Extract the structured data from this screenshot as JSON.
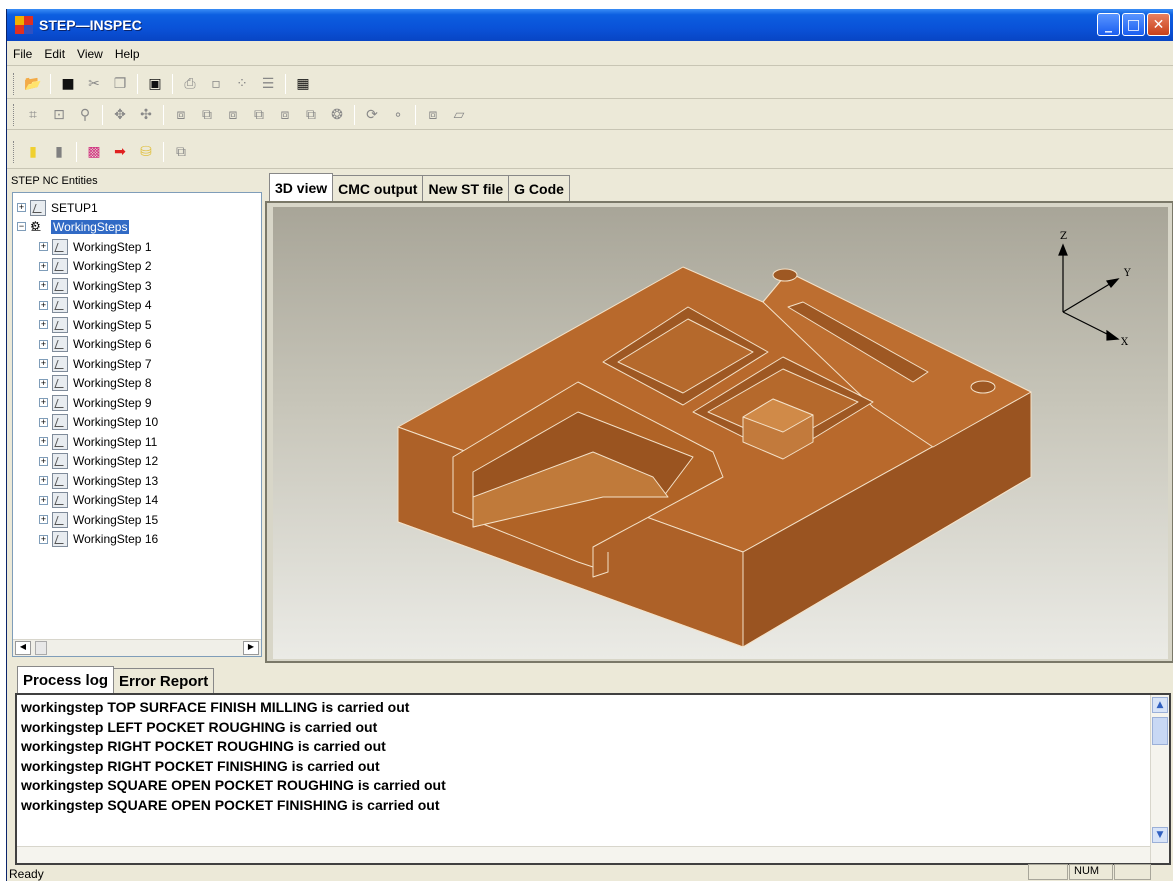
{
  "window": {
    "title": "STEP—INSPEC"
  },
  "menu": [
    "File",
    "Edit",
    "View",
    "Help"
  ],
  "tree": {
    "caption": "STEP NC Entities",
    "root_setup": "SETUP1",
    "root_workingsteps": "WorkingSteps",
    "items": [
      "WorkingStep 1",
      "WorkingStep 2",
      "WorkingStep 3",
      "WorkingStep 4",
      "WorkingStep 5",
      "WorkingStep 6",
      "WorkingStep 7",
      "WorkingStep 8",
      "WorkingStep 9",
      "WorkingStep 10",
      "WorkingStep 11",
      "WorkingStep 12",
      "WorkingStep 13",
      "WorkingStep 14",
      "WorkingStep 15",
      "WorkingStep 16"
    ]
  },
  "view_tabs": [
    "3D view",
    "CMC output",
    "New ST file",
    "G Code"
  ],
  "axes": {
    "z": "Z",
    "y": "Y",
    "x": "X"
  },
  "log_tabs": [
    "Process log",
    "Error Report"
  ],
  "log_lines": [
    "workingstep TOP SURFACE FINISH MILLING is carried out",
    "workingstep LEFT POCKET ROUGHING is carried out",
    "workingstep RIGHT POCKET ROUGHING is carried out",
    "workingstep RIGHT POCKET FINISHING is carried out",
    "workingstep SQUARE OPEN POCKET ROUGHING is carried out",
    "workingstep SQUARE OPEN POCKET FINISHING is carried out"
  ],
  "status": {
    "text": "Ready",
    "num": "NUM"
  },
  "colors": {
    "model_top": "#b8692c",
    "model_side": "#a95e25",
    "selection": "#316ac5"
  }
}
